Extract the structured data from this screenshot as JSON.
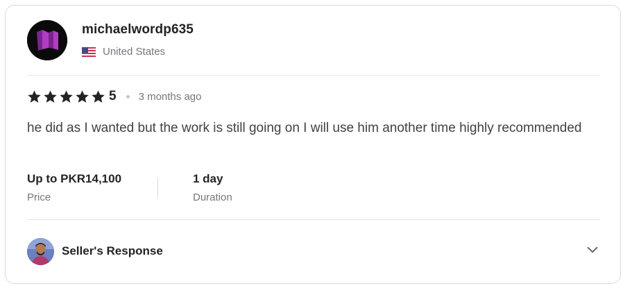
{
  "reviewer": {
    "username": "michaelwordp635",
    "country": "United States",
    "flag_icon": "us-flag-icon"
  },
  "rating": {
    "stars": 5,
    "value": "5",
    "time_ago": "3 months ago"
  },
  "review": {
    "text": "he did as I wanted but the work is still going on I will use him another time highly recommended"
  },
  "price": {
    "value": "Up to PKR14,100",
    "label": "Price"
  },
  "duration": {
    "value": "1 day",
    "label": "Duration"
  },
  "seller_response": {
    "label": "Seller's Response",
    "icon": "chevron-down-icon"
  },
  "colors": {
    "star": "#222325",
    "avatar_bg": "#0a0a0a",
    "avatar_logo": "#9b2fae"
  }
}
